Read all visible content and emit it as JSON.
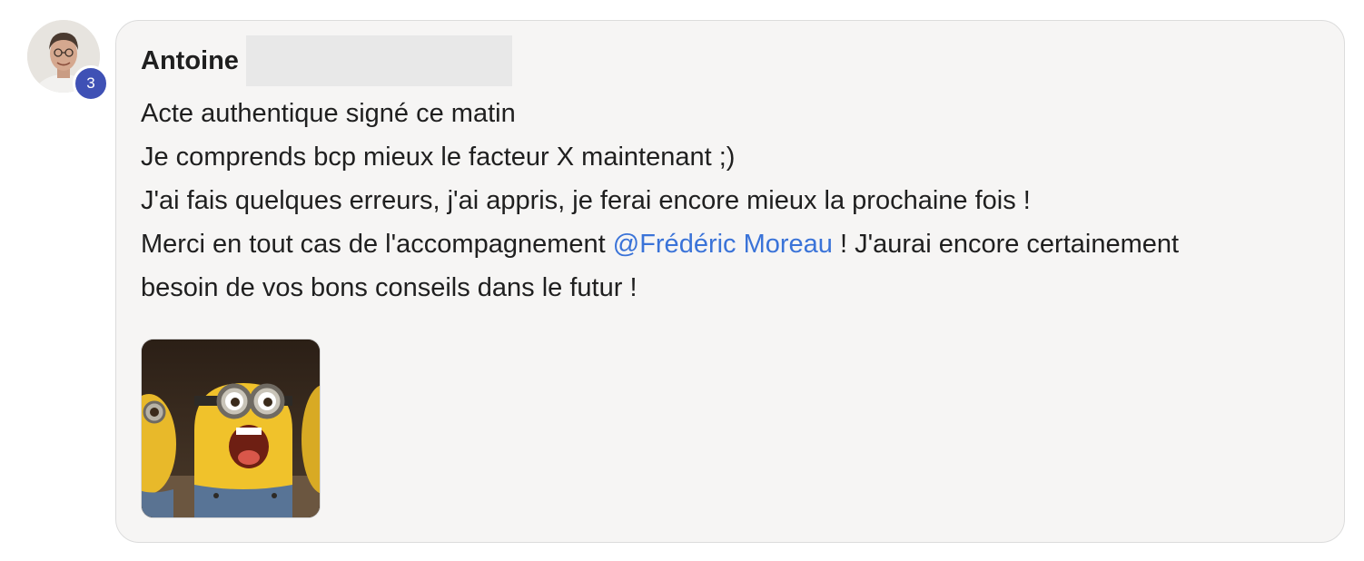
{
  "post": {
    "author": {
      "name": "Antoine",
      "badge_count": "3"
    },
    "message": {
      "line1": "Acte authentique signé ce matin",
      "line2": "Je comprends bcp mieux le facteur X maintenant ;)",
      "line3": "J'ai fais quelques erreurs, j'ai appris, je ferai encore mieux la prochaine fois !",
      "line4_before": "Merci en tout cas de l'accompagnement ",
      "mention": "@Frédéric Moreau",
      "line4_after": " ! J'aurai encore certainement",
      "line5": "besoin de vos bons conseils dans le futur !"
    },
    "attachment": {
      "type": "gif",
      "subject": "minion-celebrating"
    }
  },
  "colors": {
    "badge": "#3f51b5",
    "mention": "#3a73d8",
    "bubble_bg": "#f6f5f4"
  }
}
